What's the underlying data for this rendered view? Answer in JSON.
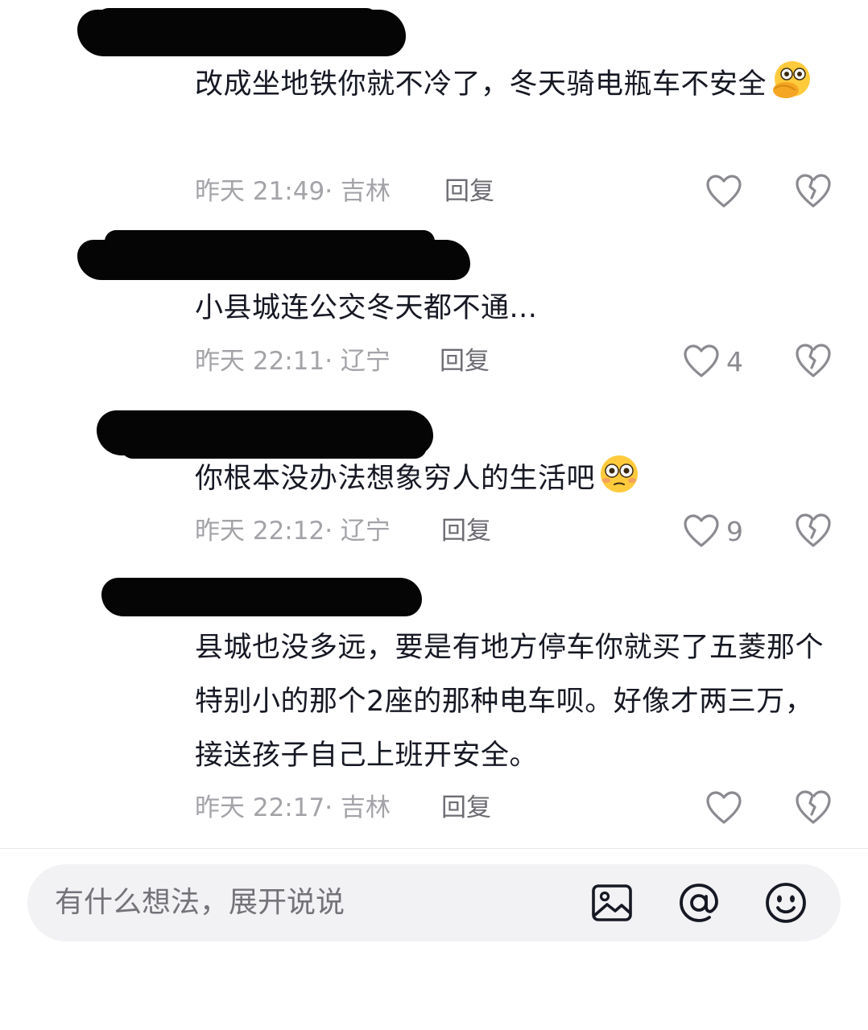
{
  "comments": [
    {
      "text": "改成坐地铁你就不冷了，冬天骑电瓶车不安全",
      "emoji": "hand-over-mouth-emoji",
      "time": "昨天 21:49",
      "location": "· 吉林",
      "reply_label": "回复",
      "like_count": ""
    },
    {
      "text": "小县城连公交冬天都不通...",
      "time": "昨天 22:11",
      "location": "· 辽宁",
      "reply_label": "回复",
      "like_count": "4"
    },
    {
      "text": "你根本没办法想象穷人的生活吧",
      "emoji": "flushed-face-emoji",
      "time": "昨天 22:12",
      "location": "· 辽宁",
      "reply_label": "回复",
      "like_count": "9"
    },
    {
      "text": "县城也没多远，要是有地方停车你就买了五菱那个特别小的那个2座的那种电车呗。好像才两三万，接送孩子自己上班开安全。",
      "time": "昨天 22:17",
      "location": "· 吉林",
      "reply_label": "回复",
      "like_count": ""
    }
  ],
  "input": {
    "placeholder": "有什么想法，展开说说"
  },
  "icons": {
    "like": "heart-outline-icon",
    "dislike": "broken-heart-icon",
    "image": "image-icon",
    "mention": "at-sign-icon",
    "emoji": "smiley-icon"
  },
  "colors": {
    "text": "#161823",
    "meta": "#a3a3a8",
    "reply": "#6c6c72",
    "input_bg": "#f2f2f4"
  }
}
